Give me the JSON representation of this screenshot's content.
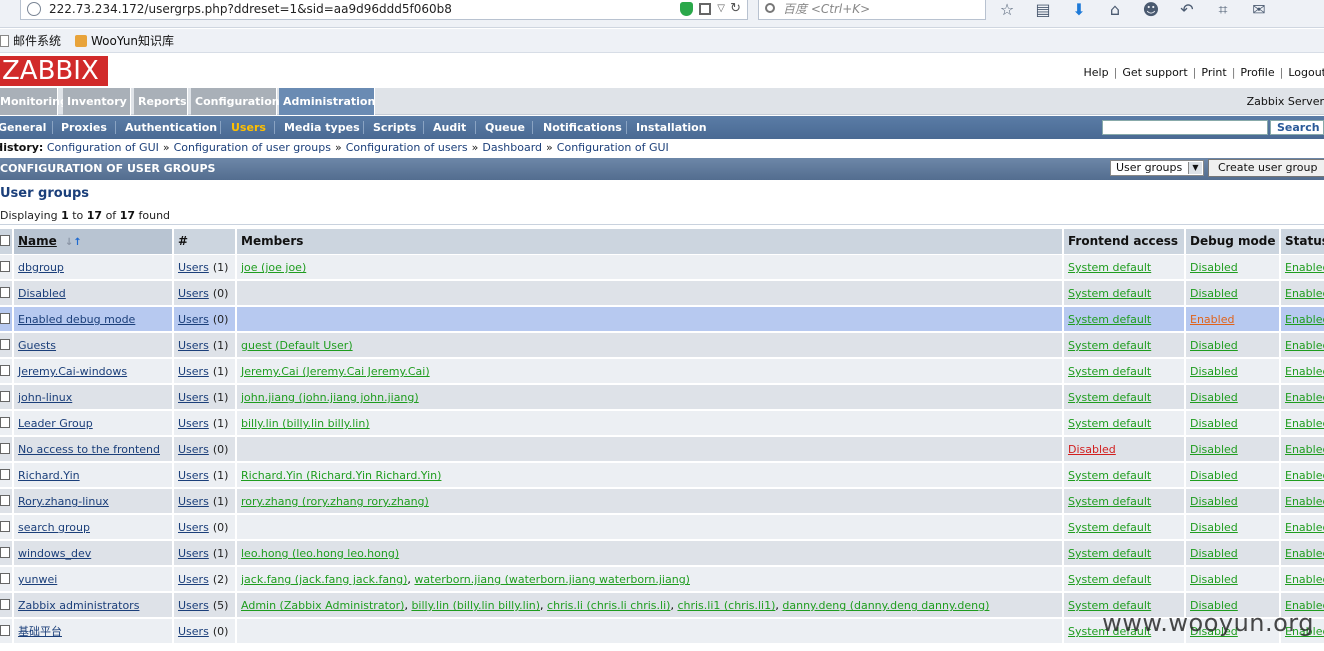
{
  "browser": {
    "url": "222.73.234.172/usergrps.php?ddreset=1&sid=aa9d96ddd5f060b8",
    "search_placeholder": "百度 <Ctrl+K>",
    "bookmarks": [
      {
        "label": "邮件系统"
      },
      {
        "label": "WooYun知识库"
      }
    ]
  },
  "header": {
    "logo": "ZABBIX",
    "links": [
      "Help",
      "Get support",
      "Print",
      "Profile",
      "Logout"
    ],
    "server": "Zabbix Server"
  },
  "main_menu": [
    "Monitoring",
    "Inventory",
    "Reports",
    "Configuration",
    "Administration"
  ],
  "main_menu_active": "Administration",
  "sub_menu": [
    "General",
    "Proxies",
    "Authentication",
    "Users",
    "Media types",
    "Scripts",
    "Audit",
    "Queue",
    "Notifications",
    "Installation"
  ],
  "sub_menu_active": "Users",
  "sub_search_button": "Search",
  "history": {
    "label": "History:",
    "items": [
      "Configuration of GUI",
      "Configuration of user groups",
      "Configuration of users",
      "Dashboard",
      "Configuration of GUI"
    ]
  },
  "titlebar": {
    "title": "CONFIGURATION OF USER GROUPS",
    "select_value": "User groups",
    "create_button": "Create user group"
  },
  "section_title": "User groups",
  "displaying": {
    "prefix": "Displaying",
    "from": "1",
    "to_word": "to",
    "to": "17",
    "of_word": "of",
    "total": "17",
    "suffix": "found"
  },
  "table": {
    "columns": [
      "Name",
      "#",
      "Members",
      "Frontend access",
      "Debug mode",
      "Status"
    ],
    "rows": [
      {
        "name": "dbgroup",
        "users": "Users",
        "count": "(1)",
        "members": [
          "joe (joe joe)"
        ],
        "frontend": "System default",
        "debug": "Disabled",
        "status": "Enabled"
      },
      {
        "name": "Disabled",
        "users": "Users",
        "count": "(0)",
        "members": [],
        "frontend": "System default",
        "debug": "Disabled",
        "status": "Enabled"
      },
      {
        "name": "Enabled debug mode",
        "users": "Users",
        "count": "(0)",
        "members": [],
        "frontend": "System default",
        "debug": "Enabled",
        "status": "Enabled"
      },
      {
        "name": "Guests",
        "users": "Users",
        "count": "(1)",
        "members": [
          "guest (Default User)"
        ],
        "frontend": "System default",
        "debug": "Disabled",
        "status": "Enabled"
      },
      {
        "name": "Jeremy.Cai-windows",
        "users": "Users",
        "count": "(1)",
        "members": [
          "Jeremy.Cai (Jeremy.Cai Jeremy.Cai)"
        ],
        "frontend": "System default",
        "debug": "Disabled",
        "status": "Enabled"
      },
      {
        "name": "john-linux",
        "users": "Users",
        "count": "(1)",
        "members": [
          "john.jiang (john.jiang john.jiang)"
        ],
        "frontend": "System default",
        "debug": "Disabled",
        "status": "Enabled"
      },
      {
        "name": "Leader Group",
        "users": "Users",
        "count": "(1)",
        "members": [
          "billy.lin (billy.lin billy.lin)"
        ],
        "frontend": "System default",
        "debug": "Disabled",
        "status": "Enabled"
      },
      {
        "name": "No access to the frontend",
        "users": "Users",
        "count": "(0)",
        "members": [],
        "frontend": "Disabled",
        "debug": "Disabled",
        "status": "Enabled"
      },
      {
        "name": "Richard.Yin",
        "users": "Users",
        "count": "(1)",
        "members": [
          "Richard.Yin (Richard.Yin Richard.Yin)"
        ],
        "frontend": "System default",
        "debug": "Disabled",
        "status": "Enabled"
      },
      {
        "name": "Rory.zhang-linux",
        "users": "Users",
        "count": "(1)",
        "members": [
          "rory.zhang (rory.zhang rory.zhang)"
        ],
        "frontend": "System default",
        "debug": "Disabled",
        "status": "Enabled"
      },
      {
        "name": "search group",
        "users": "Users",
        "count": "(0)",
        "members": [],
        "frontend": "System default",
        "debug": "Disabled",
        "status": "Enabled"
      },
      {
        "name": "windows_dev",
        "users": "Users",
        "count": "(1)",
        "members": [
          "leo.hong (leo.hong leo.hong)"
        ],
        "frontend": "System default",
        "debug": "Disabled",
        "status": "Enabled"
      },
      {
        "name": "yunwei",
        "users": "Users",
        "count": "(2)",
        "members": [
          "jack.fang (jack.fang jack.fang)",
          "waterborn.jiang (waterborn.jiang waterborn.jiang)"
        ],
        "frontend": "System default",
        "debug": "Disabled",
        "status": "Enabled"
      },
      {
        "name": "Zabbix administrators",
        "users": "Users",
        "count": "(5)",
        "members": [
          "Admin (Zabbix Administrator)",
          "billy.lin (billy.lin billy.lin)",
          "chris.li (chris.li chris.li)",
          "chris.li1 (chris.li1)",
          "danny.deng (danny.deng danny.deng)"
        ],
        "frontend": "System default",
        "debug": "Disabled",
        "status": "Enabled"
      },
      {
        "name": "基础平台",
        "users": "Users",
        "count": "(0)",
        "members": [],
        "frontend": "System default",
        "debug": "Disabled",
        "status": "Enabled"
      }
    ]
  },
  "watermark": "www.wooyun.org",
  "colors": {
    "link": "#1b3f7a",
    "green": "#1f9d1f",
    "red": "#d21e1e",
    "orange": "#e0631a",
    "logo": "#d12a2a",
    "selected_row": "#b7c9f0"
  }
}
